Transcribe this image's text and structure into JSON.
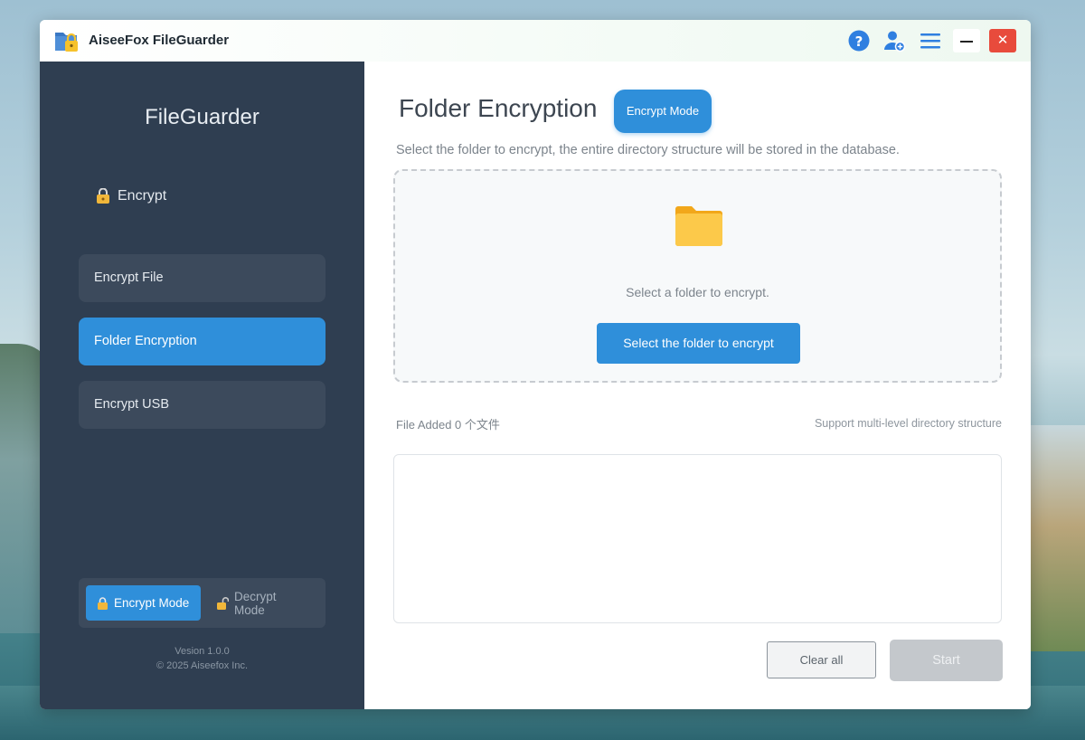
{
  "app": {
    "title": "AiseeFox FileGuarder"
  },
  "titlebar": {
    "icons": [
      "help-icon",
      "user-icon",
      "menu-icon",
      "minimize-icon",
      "close-icon"
    ],
    "close_symbol": "✕"
  },
  "sidebar": {
    "title": "FileGuarder",
    "section_label": "Encrypt",
    "items": [
      {
        "label": "Encrypt File",
        "active": false
      },
      {
        "label": "Folder Encryption",
        "active": true
      },
      {
        "label": "Encrypt USB",
        "active": false
      }
    ],
    "mode": {
      "encrypt_label": "Encrypt Mode",
      "decrypt_label": "Decrypt Mode",
      "selected": "Encrypt Mode"
    },
    "version": "Vesion 1.0.0",
    "copyright": "© 2025 Aiseefox Inc."
  },
  "main": {
    "title": "Folder Encryption",
    "mode_badge": "Encrypt Mode",
    "description": "Select the folder to encrypt, the entire directory structure will be stored in the database.",
    "dropzone": {
      "hint": "Select a folder to encrypt.",
      "button_label": "Select the folder to encrypt"
    },
    "files_added": "File Added 0 个文件",
    "support_note": "Support multi-level directory structure",
    "clear_label": "Clear all",
    "start_label": "Start"
  },
  "colors": {
    "accent": "#2f8fda",
    "sidebar_bg": "#2f3e51",
    "sidebar_item_bg": "#3c4a5c",
    "close_red": "#e84b3c",
    "disabled_gray": "#c4c8cc"
  }
}
